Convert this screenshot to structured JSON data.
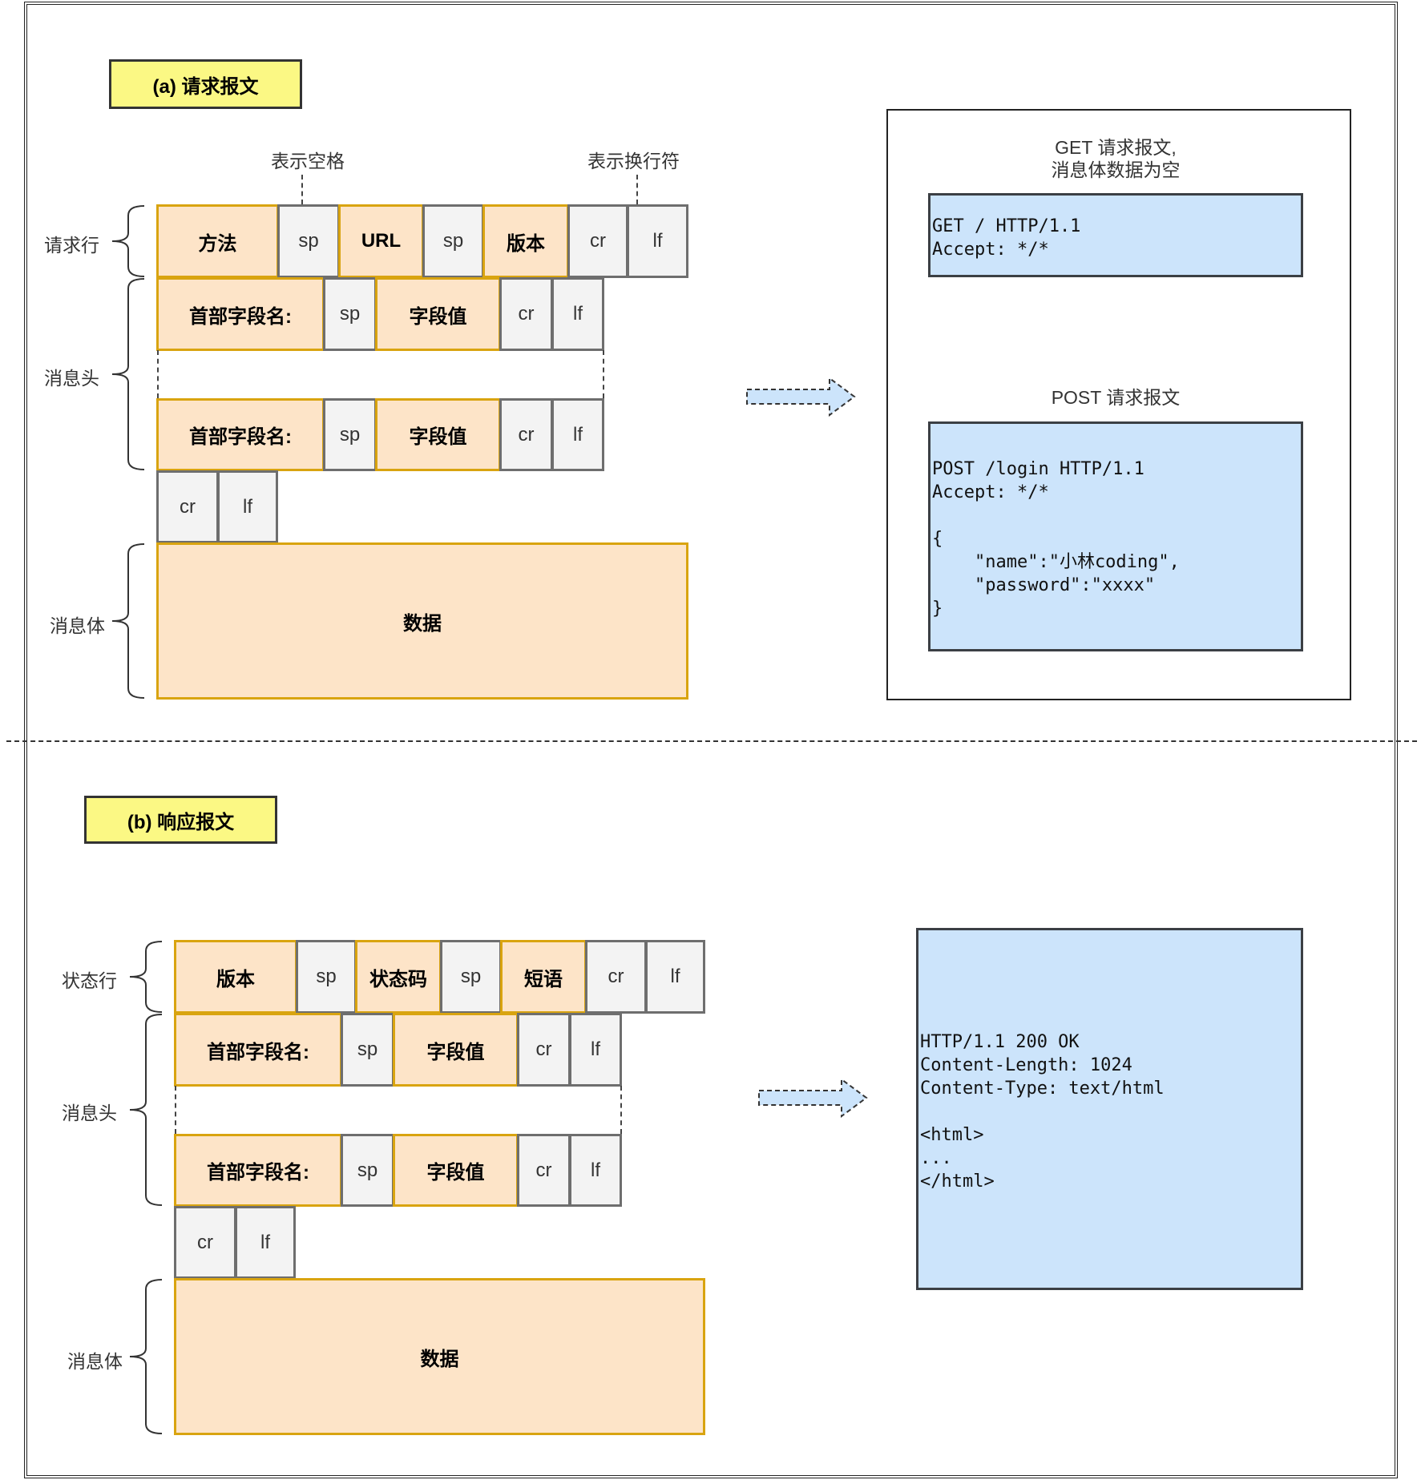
{
  "request": {
    "title": "(a) 请求报文",
    "annotations": {
      "space": "表示空格",
      "newline": "表示换行符"
    },
    "labels": {
      "request_line": "请求行",
      "headers": "消息头",
      "body": "消息体"
    },
    "request_line": [
      "方法",
      "sp",
      "URL",
      "sp",
      "版本",
      "cr",
      "lf"
    ],
    "header_row": [
      "首部字段名:",
      "sp",
      "字段值",
      "cr",
      "lf"
    ],
    "blank_line": [
      "cr",
      "lf"
    ],
    "body": "数据",
    "examples": {
      "get_caption_line1": "GET 请求报文,",
      "get_caption_line2": "消息体数据为空",
      "get_code": "GET / HTTP/1.1\nAccept: */*",
      "post_caption": "POST 请求报文",
      "post_code": "POST /login HTTP/1.1\nAccept: */*\n\n{\n    \"name\":\"小林coding\",\n    \"password\":\"xxxx\"\n}"
    }
  },
  "response": {
    "title": "(b) 响应报文",
    "labels": {
      "status_line": "状态行",
      "headers": "消息头",
      "body": "消息体"
    },
    "status_line": [
      "版本",
      "sp",
      "状态码",
      "sp",
      "短语",
      "cr",
      "lf"
    ],
    "header_row": [
      "首部字段名:",
      "sp",
      "字段值",
      "cr",
      "lf"
    ],
    "blank_line": [
      "cr",
      "lf"
    ],
    "body": "数据",
    "example_code": "HTTP/1.1 200 OK\nContent-Length: 1024\nContent-Type: text/html\n\n<html>\n...\n</html>"
  },
  "colors": {
    "field_fill": "#fde4c8",
    "field_border": "#d9a410",
    "ctrl_fill": "#f3f3f3",
    "ctrl_border": "#6e6e6e",
    "title_fill": "#fbf884",
    "code_fill": "#cce4fb"
  }
}
